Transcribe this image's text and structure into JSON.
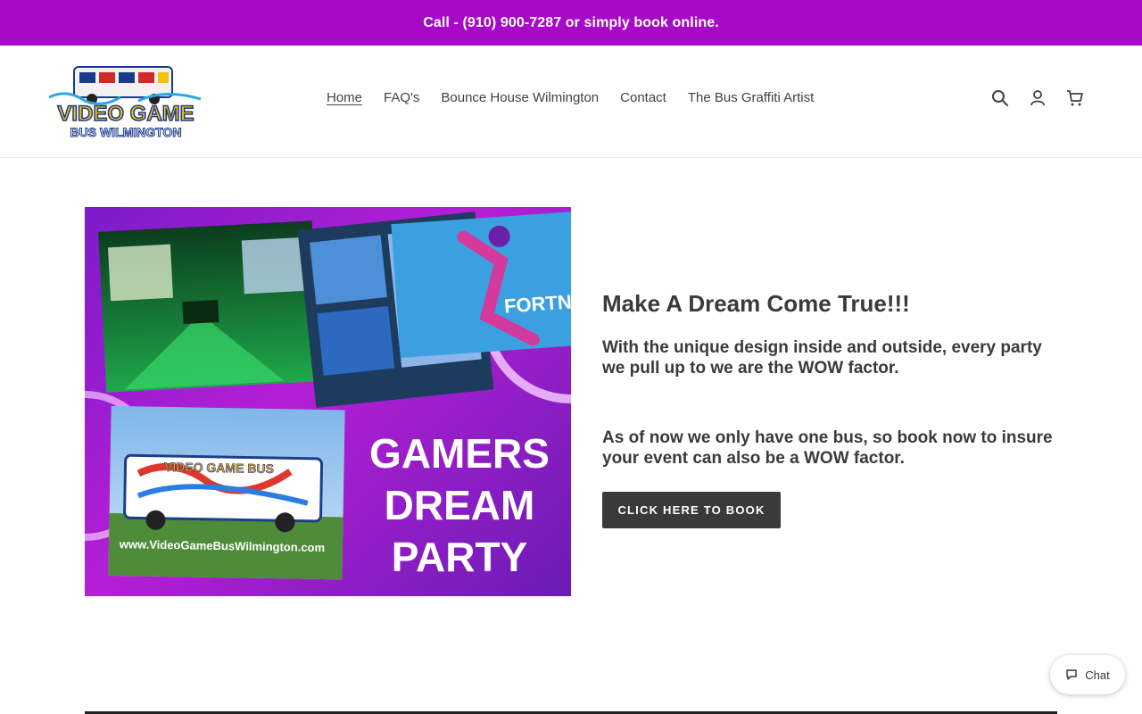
{
  "announcement": {
    "text": "Call - (910) 900-7287 or simply book online."
  },
  "header": {
    "logo": {
      "line1": "VIDEO GAME",
      "line2": "BUS WILMINGTON"
    },
    "nav": [
      {
        "label": "Home",
        "active": true
      },
      {
        "label": "FAQ's"
      },
      {
        "label": "Bounce House Wilmington"
      },
      {
        "label": "Contact"
      },
      {
        "label": "The Bus Graffiti Artist"
      }
    ],
    "icons": [
      "search-icon",
      "account-icon",
      "cart-icon"
    ]
  },
  "hero": {
    "image": {
      "big_text": [
        "GAMERS",
        "DREAM",
        "PARTY"
      ],
      "url_text": "www.VideoGameBusWilmington.com",
      "game_text": "FORTNI",
      "bus_text": "VIDEO GAME BUS"
    },
    "heading": "Make A Dream Come True!!!",
    "paragraph1": "With the unique design inside and outside, every party we pull up to we are the WOW factor.",
    "paragraph2": "As of now we only have one bus, so book now to insure your event can also be a WOW factor.",
    "button_label": "CLICK HERE TO BOOK"
  },
  "chat": {
    "label": "Chat"
  },
  "colors": {
    "brand_purple": "#a60ac6",
    "button_dark": "#3a3a3a"
  }
}
